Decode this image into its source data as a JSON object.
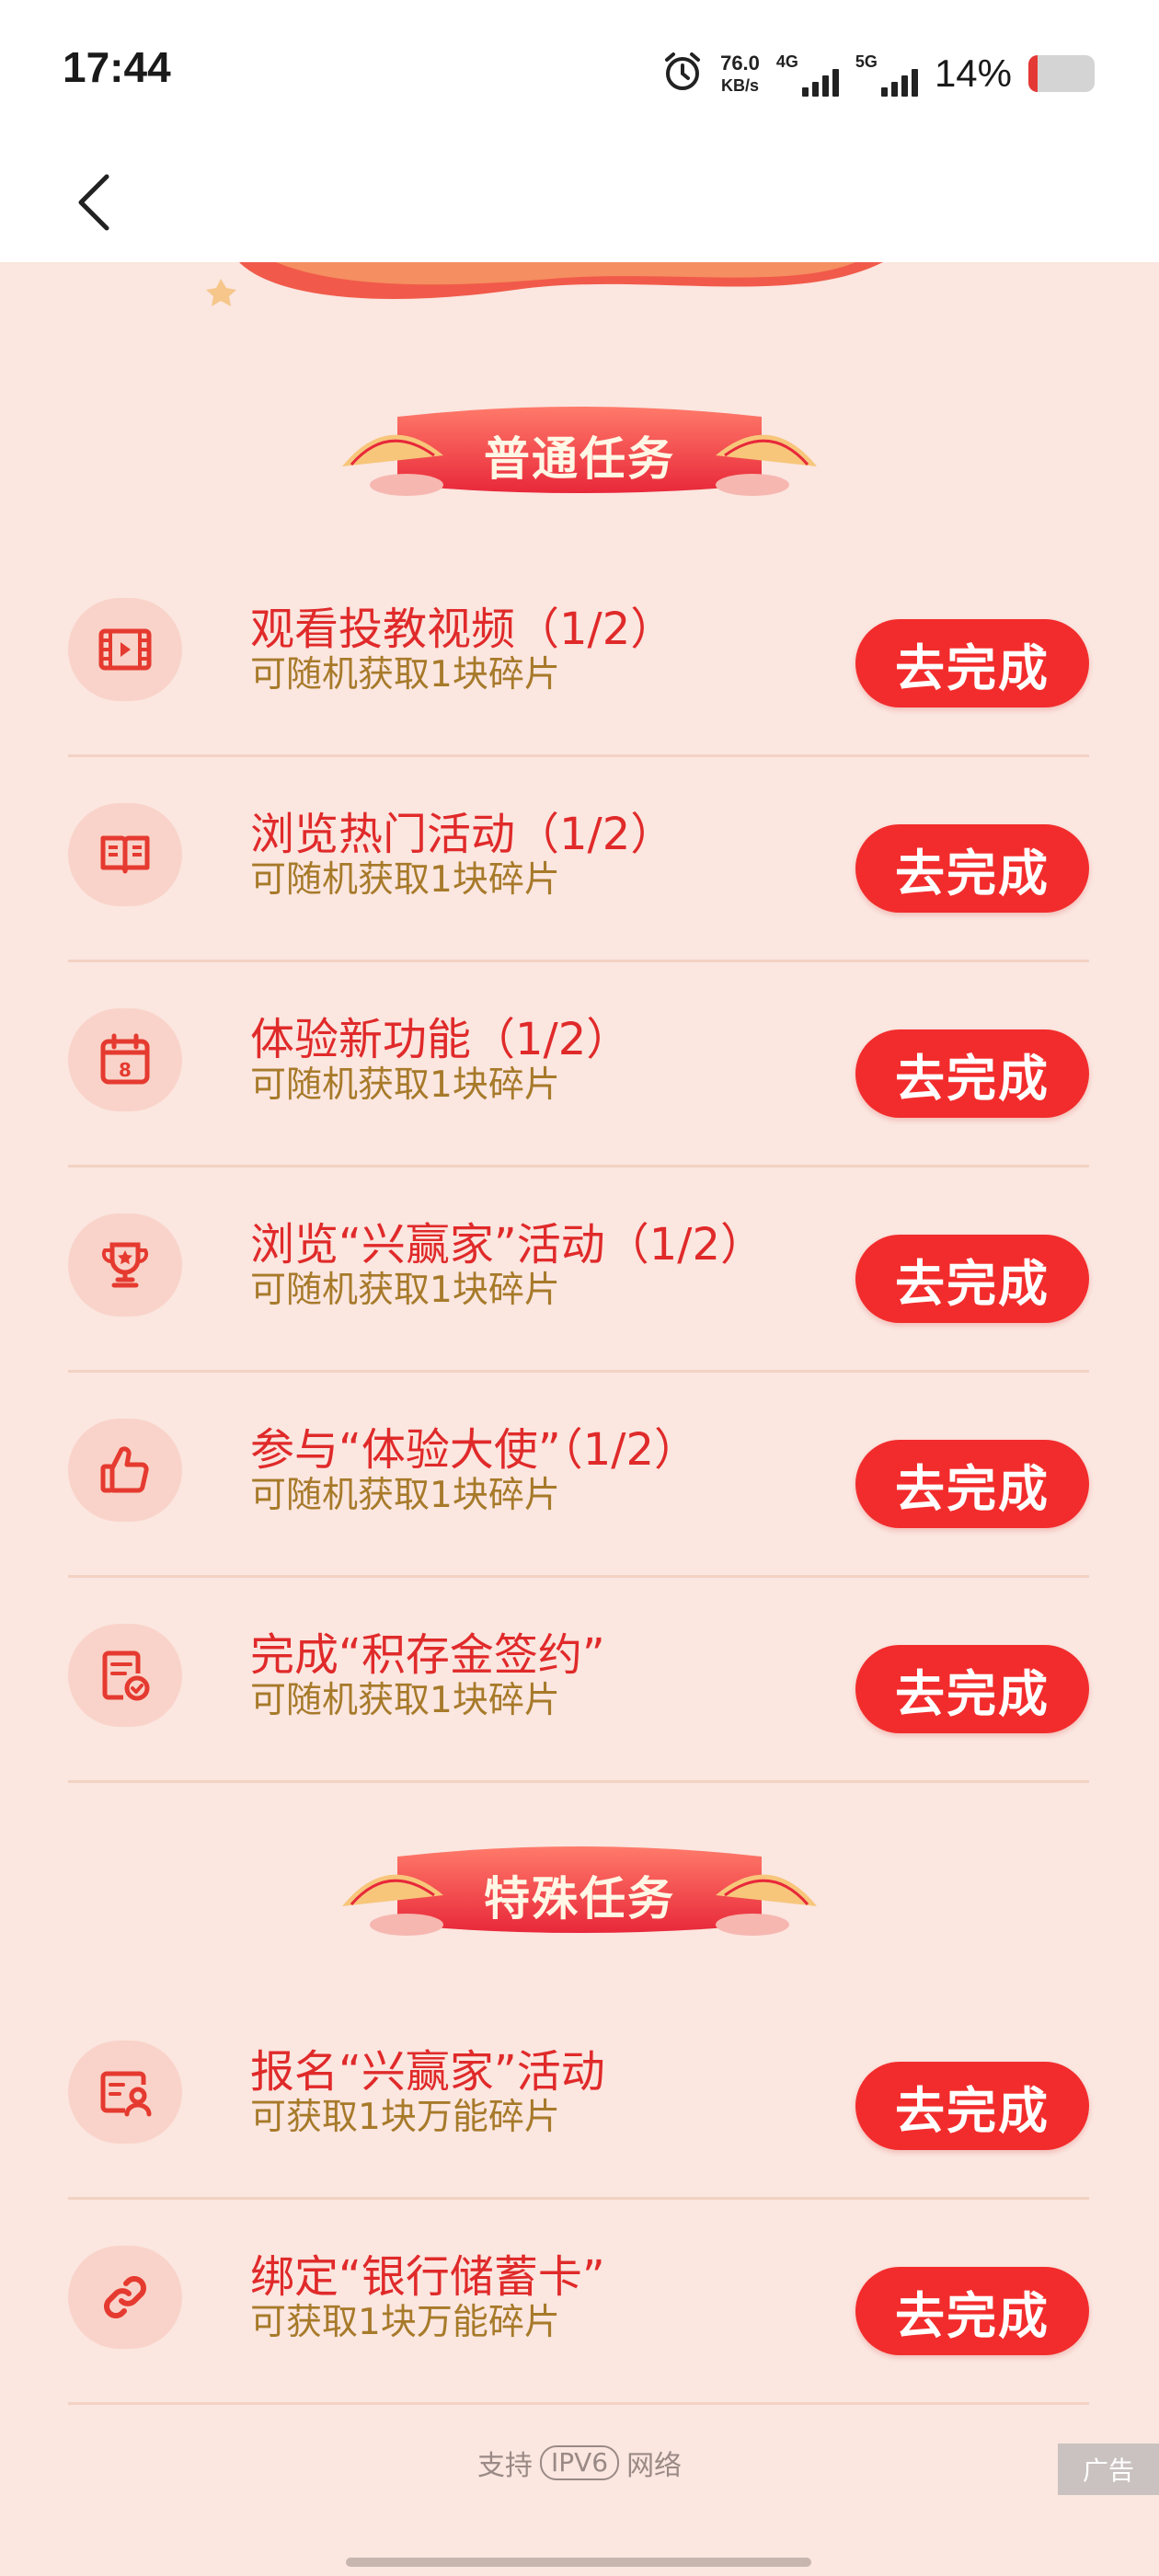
{
  "status_bar": {
    "time": "17:44",
    "net_speed_value": "76.0",
    "net_speed_unit": "KB/s",
    "network_1": "4G",
    "network_2": "5G",
    "battery_percent": "14%",
    "battery_level": 0.14,
    "icons": [
      "alarm-icon",
      "signal-icon",
      "battery-icon"
    ]
  },
  "nav": {
    "back_icon": "back-arrow-icon"
  },
  "sections": {
    "normal": {
      "title": "普通任务"
    },
    "special": {
      "title": "特殊任务"
    }
  },
  "colors": {
    "background": "#fbe6e0",
    "accent": "#f22c2c",
    "title_text": "#e02a2a",
    "sub_text": "#a77a2a"
  },
  "normal_tasks": [
    {
      "icon": "video-icon",
      "title": "观看投教视频（1/2）",
      "subtitle": "可随机获取1块碎片",
      "button": "去完成"
    },
    {
      "icon": "book-icon",
      "title": "浏览热门活动（1/2）",
      "subtitle": "可随机获取1块碎片",
      "button": "去完成"
    },
    {
      "icon": "calendar-icon",
      "title": "体验新功能（1/2）",
      "subtitle": "可随机获取1块碎片",
      "button": "去完成"
    },
    {
      "icon": "trophy-icon",
      "title": "浏览“兴赢家”活动（1/2）",
      "subtitle": "可随机获取1块碎片",
      "button": "去完成"
    },
    {
      "icon": "thumbs-up-icon",
      "title": "参与“体验大使”（1/2）",
      "subtitle": "可随机获取1块碎片",
      "button": "去完成"
    },
    {
      "icon": "contract-icon",
      "title": "完成“积存金签约”",
      "subtitle": "可随机获取1块碎片",
      "button": "去完成"
    }
  ],
  "special_tasks": [
    {
      "icon": "profile-card-icon",
      "title": "报名“兴赢家”活动",
      "subtitle": "可获取1块万能碎片",
      "button": "去完成"
    },
    {
      "icon": "link-icon",
      "title": "绑定“银行储蓄卡”",
      "subtitle": "可获取1块万能碎片",
      "button": "去完成"
    }
  ],
  "footer": {
    "prefix": "支持",
    "badge": "IPV6",
    "suffix": "网络",
    "ad_label": "广告"
  }
}
